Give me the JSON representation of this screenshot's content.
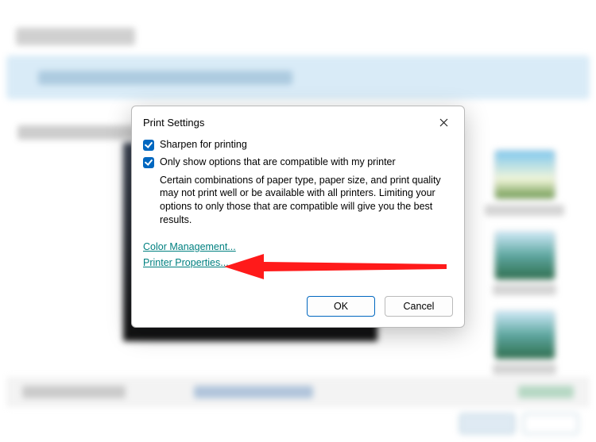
{
  "dialog": {
    "title": "Print Settings",
    "sharpen": {
      "label": "Sharpen for printing",
      "checked": true
    },
    "compat": {
      "label": "Only show options that are compatible with my printer",
      "checked": true,
      "description": "Certain combinations of paper type, paper size, and print quality may not print well or be available with all printers.  Limiting your options to only those that are compatible will give you the best results."
    },
    "links": {
      "color_management": "Color Management...",
      "printer_properties": "Printer Properties..."
    },
    "buttons": {
      "ok": "OK",
      "cancel": "Cancel"
    }
  }
}
